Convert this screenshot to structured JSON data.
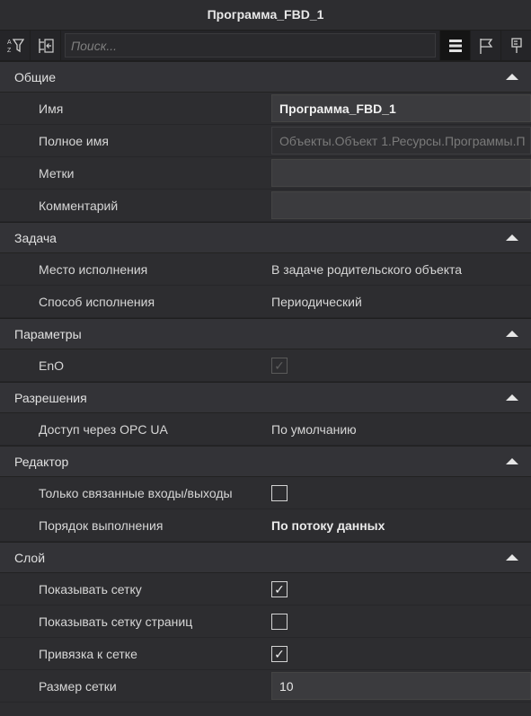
{
  "window": {
    "title": "Программа_FBD_1"
  },
  "toolbar": {
    "search_placeholder": "Поиск...",
    "left_icons": [
      "sort-az-filter-icon",
      "collapse-tree-icon"
    ],
    "right_icons": [
      "list-view-icon",
      "flag-icon",
      "pin-icon"
    ]
  },
  "sections": {
    "general": {
      "title": "Общие",
      "name_label": "Имя",
      "name_value": "Программа_FBD_1",
      "fullname_label": "Полное имя",
      "fullname_value": "Объекты.Объект 1.Ресурсы.Программы.П",
      "tags_label": "Метки",
      "tags_value": "",
      "comment_label": "Комментарий",
      "comment_value": ""
    },
    "task": {
      "title": "Задача",
      "place_label": "Место исполнения",
      "place_value": "В задаче родительского объекта",
      "mode_label": "Способ исполнения",
      "mode_value": "Периодический"
    },
    "params": {
      "title": "Параметры",
      "eno_label": "EnO",
      "eno_checked": true,
      "eno_disabled": true
    },
    "permissions": {
      "title": "Разрешения",
      "opc_label": "Доступ через OPC UA",
      "opc_value": "По умолчанию"
    },
    "editor": {
      "title": "Редактор",
      "linked_label": "Только связанные входы/выходы",
      "linked_checked": false,
      "order_label": "Порядок выполнения",
      "order_value": "По потоку данных"
    },
    "layer": {
      "title": "Слой",
      "grid_label": "Показывать сетку",
      "grid_checked": true,
      "pagegrid_label": "Показывать сетку страниц",
      "pagegrid_checked": false,
      "snap_label": "Привязка к сетке",
      "snap_checked": true,
      "gridsize_label": "Размер сетки",
      "gridsize_value": "10"
    }
  },
  "colors": {
    "background": "#2d2d30",
    "header": "#333337",
    "field": "#3b3b3e"
  }
}
